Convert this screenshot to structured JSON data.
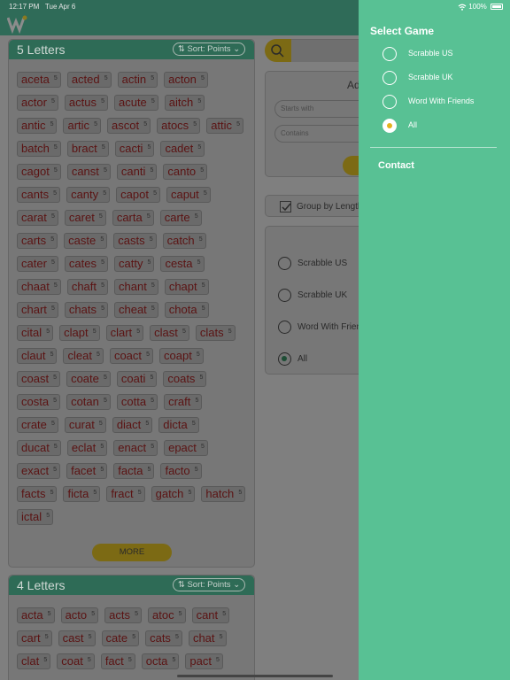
{
  "status": {
    "time": "12:17 PM",
    "date": "Tue Apr 6",
    "battery": "100%"
  },
  "five_letters": {
    "title": "5 Letters",
    "sort_label": "⇅ Sort: Points ⌄",
    "more_label": "MORE",
    "words": [
      "aceta",
      "acted",
      "actin",
      "acton",
      "actor",
      "actus",
      "acute",
      "aitch",
      "antic",
      "artic",
      "ascot",
      "atocs",
      "attic",
      "batch",
      "bract",
      "cacti",
      "cadet",
      "cagot",
      "canst",
      "canti",
      "canto",
      "cants",
      "canty",
      "capot",
      "caput",
      "carat",
      "caret",
      "carta",
      "carte",
      "carts",
      "caste",
      "casts",
      "catch",
      "cater",
      "cates",
      "catty",
      "cesta",
      "chaat",
      "chaft",
      "chant",
      "chapt",
      "chart",
      "chats",
      "cheat",
      "chota",
      "cital",
      "clapt",
      "clart",
      "clast",
      "clats",
      "claut",
      "cleat",
      "coact",
      "coapt",
      "coast",
      "coate",
      "coati",
      "coats",
      "costa",
      "cotan",
      "cotta",
      "craft",
      "crate",
      "curat",
      "diact",
      "dicta",
      "ducat",
      "eclat",
      "enact",
      "epact",
      "exact",
      "facet",
      "facta",
      "facto",
      "facts",
      "ficta",
      "fract",
      "gatch",
      "hatch",
      "ictal"
    ],
    "points": "5"
  },
  "four_letters": {
    "title": "4 Letters",
    "sort_label": "⇅ Sort: Points ⌄",
    "words": [
      "acta",
      "acto",
      "acts",
      "atoc",
      "cant",
      "cart",
      "cast",
      "cate",
      "cats",
      "chat",
      "clat",
      "coat",
      "fact",
      "octa",
      "pact"
    ],
    "points": "5"
  },
  "underlay": {
    "adv_title": "Ad",
    "starts_with": "Starts with",
    "contains": "Contains",
    "group_label": "Group by Length",
    "games": [
      "Scrabble US",
      "Scrabble UK",
      "Word With Friends",
      "All"
    ]
  },
  "drawer": {
    "title": "Select Game",
    "options": [
      "Scrabble US",
      "Scrabble UK",
      "Word With Friends",
      "All"
    ],
    "selected": "All",
    "contact_label": "Contact"
  },
  "colors": {
    "drawer_bg": "#58c194",
    "header_green": "#2f6b58",
    "accent_yellow": "#e3b21f"
  }
}
